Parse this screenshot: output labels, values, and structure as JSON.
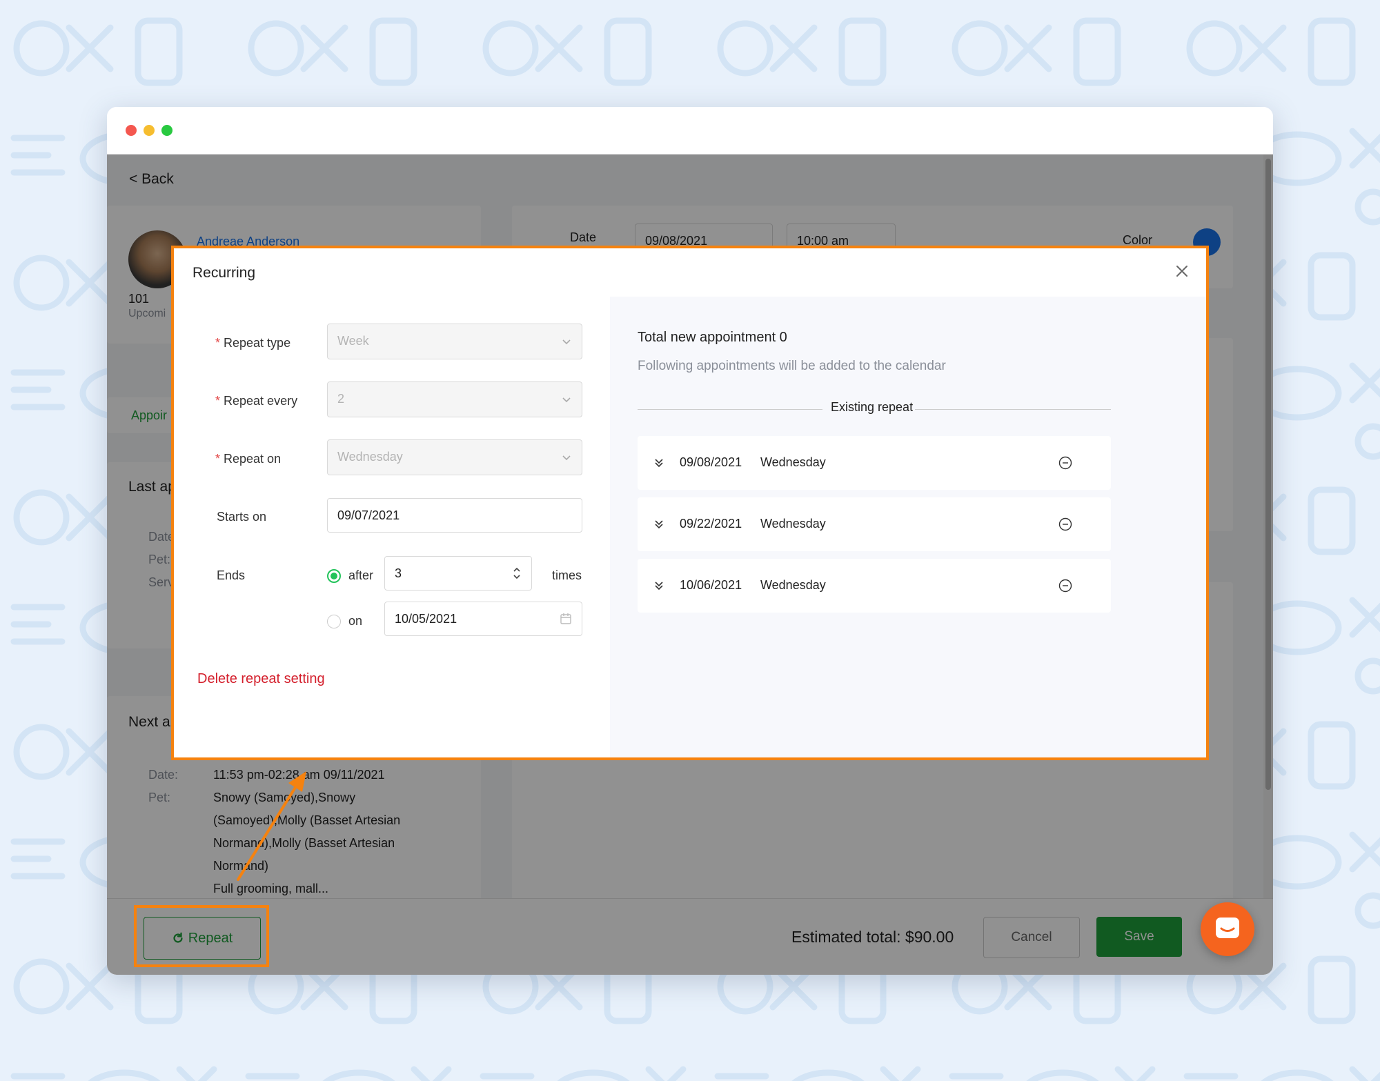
{
  "page": {
    "back_label": "< Back",
    "customer": {
      "name": "Andreae Anderson",
      "count": "101",
      "upcoming_label": "Upcomi"
    },
    "appointment_tab": "Appoir",
    "last_section": "Last ap",
    "last_fields": [
      "Date",
      "Pet:",
      "Serv"
    ],
    "next_section": "Next a",
    "next_details": {
      "date_label": "Date:",
      "date_value": "11:53 pm-02:28 am 09/11/2021",
      "pet_label": "Pet:",
      "pet_lines": [
        "Snowy (Samoyed),Snowy",
        "(Samoyed),Molly (Basset Artesian",
        "Normand),Molly (Basset Artesian",
        "Normand)"
      ],
      "services_value": "Full grooming, mall..."
    },
    "top_form": {
      "date_label": "Date",
      "date_value": "09/08/2021",
      "time_value": "10:00 am",
      "color_label": "Color"
    }
  },
  "footer": {
    "repeat_label": "Repeat",
    "estimated_total": "Estimated total: $90.00",
    "cancel_label": "Cancel",
    "save_label": "Save"
  },
  "modal": {
    "title": "Recurring",
    "fields": {
      "repeat_type_label": "Repeat type",
      "repeat_type_value": "Week",
      "repeat_every_label": "Repeat every",
      "repeat_every_value": "2",
      "repeat_on_label": "Repeat on",
      "repeat_on_value": "Wednesday",
      "starts_on_label": "Starts on",
      "starts_on_value": "09/07/2021",
      "ends_label": "Ends",
      "after_label": "after",
      "after_value": "3",
      "times_label": "times",
      "on_label": "on",
      "on_value": "10/05/2021"
    },
    "delete_label": "Delete repeat setting",
    "summary_title": "Total new appointment 0",
    "summary_subtitle": "Following appointments will be added to the calendar",
    "existing_label": "Existing repeat",
    "appointments": [
      {
        "date": "09/08/2021",
        "day": "Wednesday"
      },
      {
        "date": "09/22/2021",
        "day": "Wednesday"
      },
      {
        "date": "10/06/2021",
        "day": "Wednesday"
      }
    ]
  },
  "colors": {
    "accent_orange": "#f5820f",
    "save_green": "#1e9e3a",
    "delete_red": "#d4202d",
    "radio_green": "#22c35a"
  }
}
